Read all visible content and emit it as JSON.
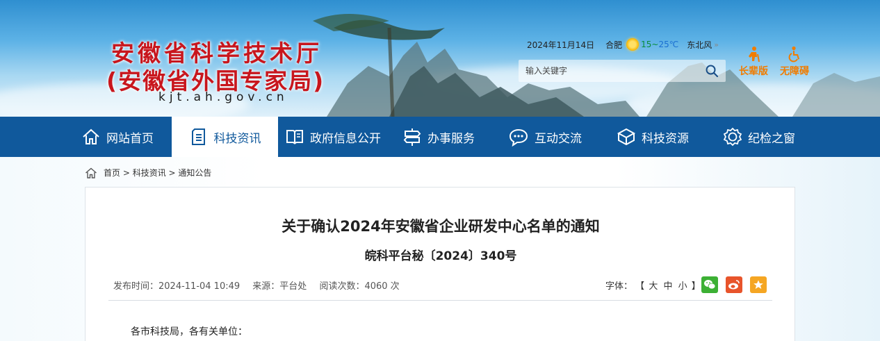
{
  "header": {
    "title": "安徽省科学技术厅",
    "subtitle": "(安徽省外国专家局)",
    "domain": "kjt.ah.gov.cn",
    "date": "2024年11月14日",
    "city": "合肥",
    "temp_low": "15",
    "temp_sep": "~",
    "temp_high": "25℃",
    "wind": "东北风",
    "search_placeholder": "输入关键字",
    "elder_label": "长辈版",
    "accessibility_label": "无障碍"
  },
  "nav": {
    "items": [
      {
        "label": "网站首页",
        "icon": "home-icon"
      },
      {
        "label": "科技资讯",
        "icon": "document-icon"
      },
      {
        "label": "政府信息公开",
        "icon": "book-icon"
      },
      {
        "label": "办事服务",
        "icon": "signpost-icon"
      },
      {
        "label": "互动交流",
        "icon": "chat-icon"
      },
      {
        "label": "科技资源",
        "icon": "cube-icon"
      },
      {
        "label": "纪检之窗",
        "icon": "badge-icon"
      }
    ],
    "active_index": 1
  },
  "breadcrumb": {
    "home": "首页",
    "sep": " > ",
    "level1": "科技资讯",
    "level2": "通知公告"
  },
  "article": {
    "title": "关于确认2024年安徽省企业研发中心名单的通知",
    "number": "皖科平台秘〔2024〕340号",
    "publish_time": "发布时间：2024-11-04 10:49",
    "source": "来源：平台处",
    "views": "阅读次数：4060 次",
    "font_label": "字体：",
    "font_open": "【",
    "font_large": "大",
    "font_medium": "中",
    "font_small": "小",
    "font_close": "】",
    "greeting": "各市科技局，各有关单位："
  },
  "share": {
    "wechat_color": "#3cb034",
    "weibo_color": "#e8542b",
    "favorite_color": "#f5a623"
  },
  "colors": {
    "nav_bg": "#10599c",
    "title_red": "#c8161d",
    "accent_orange": "#f07c00"
  }
}
